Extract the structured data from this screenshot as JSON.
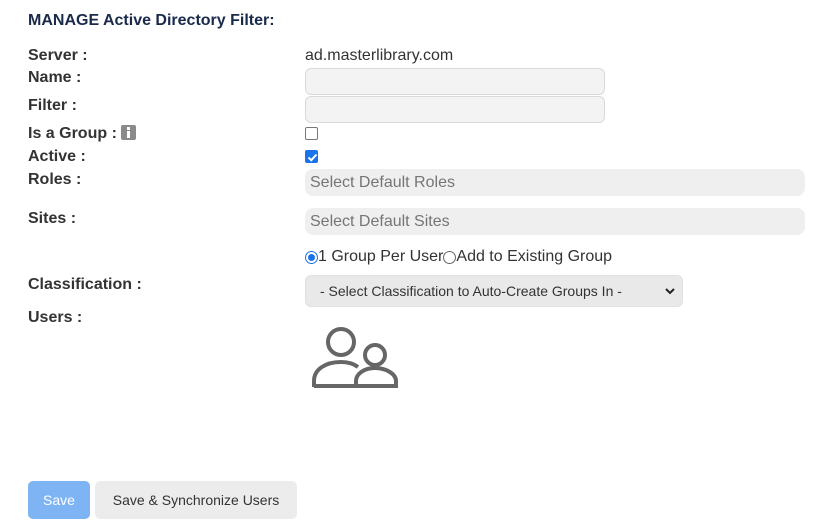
{
  "page": {
    "title": "MANAGE Active Directory Filter:"
  },
  "form": {
    "server_label": "Server :",
    "server_value": "ad.masterlibrary.com",
    "name_label": "Name :",
    "name_value": "",
    "filter_label": "Filter :",
    "filter_value": "",
    "is_group_label": "Is a Group :",
    "is_group_checked": false,
    "active_label": "Active :",
    "active_checked": true,
    "roles_label": "Roles :",
    "roles_placeholder": "Select Default Roles",
    "sites_label": "Sites :",
    "sites_placeholder": "Select Default Sites",
    "radio_options": [
      "1 Group Per User",
      "Add to Existing Group"
    ],
    "radio_selected": "1 Group Per User",
    "classification_label": "Classification :",
    "classification_selected": "- Select Classification to Auto-Create Groups In -",
    "users_label": "Users :"
  },
  "icons": {
    "info": "info-icon",
    "users": "users-icon",
    "select_chevron": "chevron-down-icon"
  },
  "buttons": {
    "save_label": "Save",
    "sync_label": "Save & Synchronize Users"
  },
  "colors": {
    "title": "#1a2a4a",
    "accent": "#1a73e8",
    "save_button": "#7fb4f4"
  }
}
